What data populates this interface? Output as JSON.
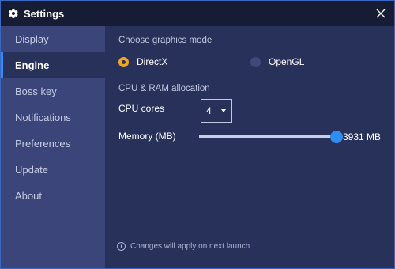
{
  "window": {
    "title": "Settings",
    "icons": {
      "title": "gear-icon",
      "close": "close-icon"
    }
  },
  "sidebar": {
    "items": [
      {
        "label": "Display",
        "active": false
      },
      {
        "label": "Engine",
        "active": true
      },
      {
        "label": "Boss key",
        "active": false
      },
      {
        "label": "Notifications",
        "active": false
      },
      {
        "label": "Preferences",
        "active": false
      },
      {
        "label": "Update",
        "active": false
      },
      {
        "label": "About",
        "active": false
      }
    ]
  },
  "engine": {
    "graphics_title": "Choose graphics mode",
    "graphics_options": [
      {
        "label": "DirectX",
        "selected": true
      },
      {
        "label": "OpenGL",
        "selected": false
      }
    ],
    "cpu_ram_title": "CPU & RAM allocation",
    "cpu_label": "CPU cores",
    "cpu_value": "4",
    "memory_label": "Memory (MB)",
    "memory_value_text": "3931 MB",
    "memory_slider_fraction": 0.98,
    "footer_note": "Changes will apply on next launch"
  },
  "colors": {
    "accent": "#2f8cf0",
    "radio_selected": "#f0a622",
    "sidebar_bg": "#3b4579",
    "content_bg": "#27315a",
    "titlebar_bg": "#151c34"
  }
}
